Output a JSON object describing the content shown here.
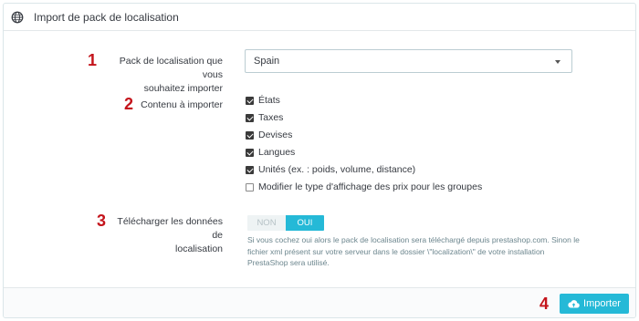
{
  "header": {
    "title": "Import de pack de localisation",
    "icon": "globe-icon"
  },
  "steps": {
    "s1": "1",
    "s2": "2",
    "s3": "3",
    "s4": "4"
  },
  "pack": {
    "label_line1": "Pack de localisation que vous",
    "label_line2": "souhaitez importer",
    "selected": "Spain"
  },
  "content": {
    "label": "Contenu à importer",
    "options": [
      {
        "label": "États",
        "checked": true
      },
      {
        "label": "Taxes",
        "checked": true
      },
      {
        "label": "Devises",
        "checked": true
      },
      {
        "label": "Langues",
        "checked": true
      },
      {
        "label": "Unités (ex. : poids, volume, distance)",
        "checked": true
      },
      {
        "label": "Modifier le type d'affichage des prix pour les groupes",
        "checked": false
      }
    ]
  },
  "download": {
    "label_line1": "Télécharger les données de",
    "label_line2": "localisation",
    "off_label": "NON",
    "on_label": "OUI",
    "value": "OUI",
    "help_line1": "Si vous cochez oui alors le pack de localisation sera téléchargé depuis prestashop.com. Sinon le",
    "help_line2": "fichier xml présent sur votre serveur dans le dossier \\\"localization\\\" de votre installation",
    "help_line3": "PrestaShop sera utilisé."
  },
  "footer": {
    "import_label": "Importer",
    "icon": "cloud-upload-icon"
  },
  "colors": {
    "accent": "#25b9d7",
    "step_number": "#c4141b"
  }
}
